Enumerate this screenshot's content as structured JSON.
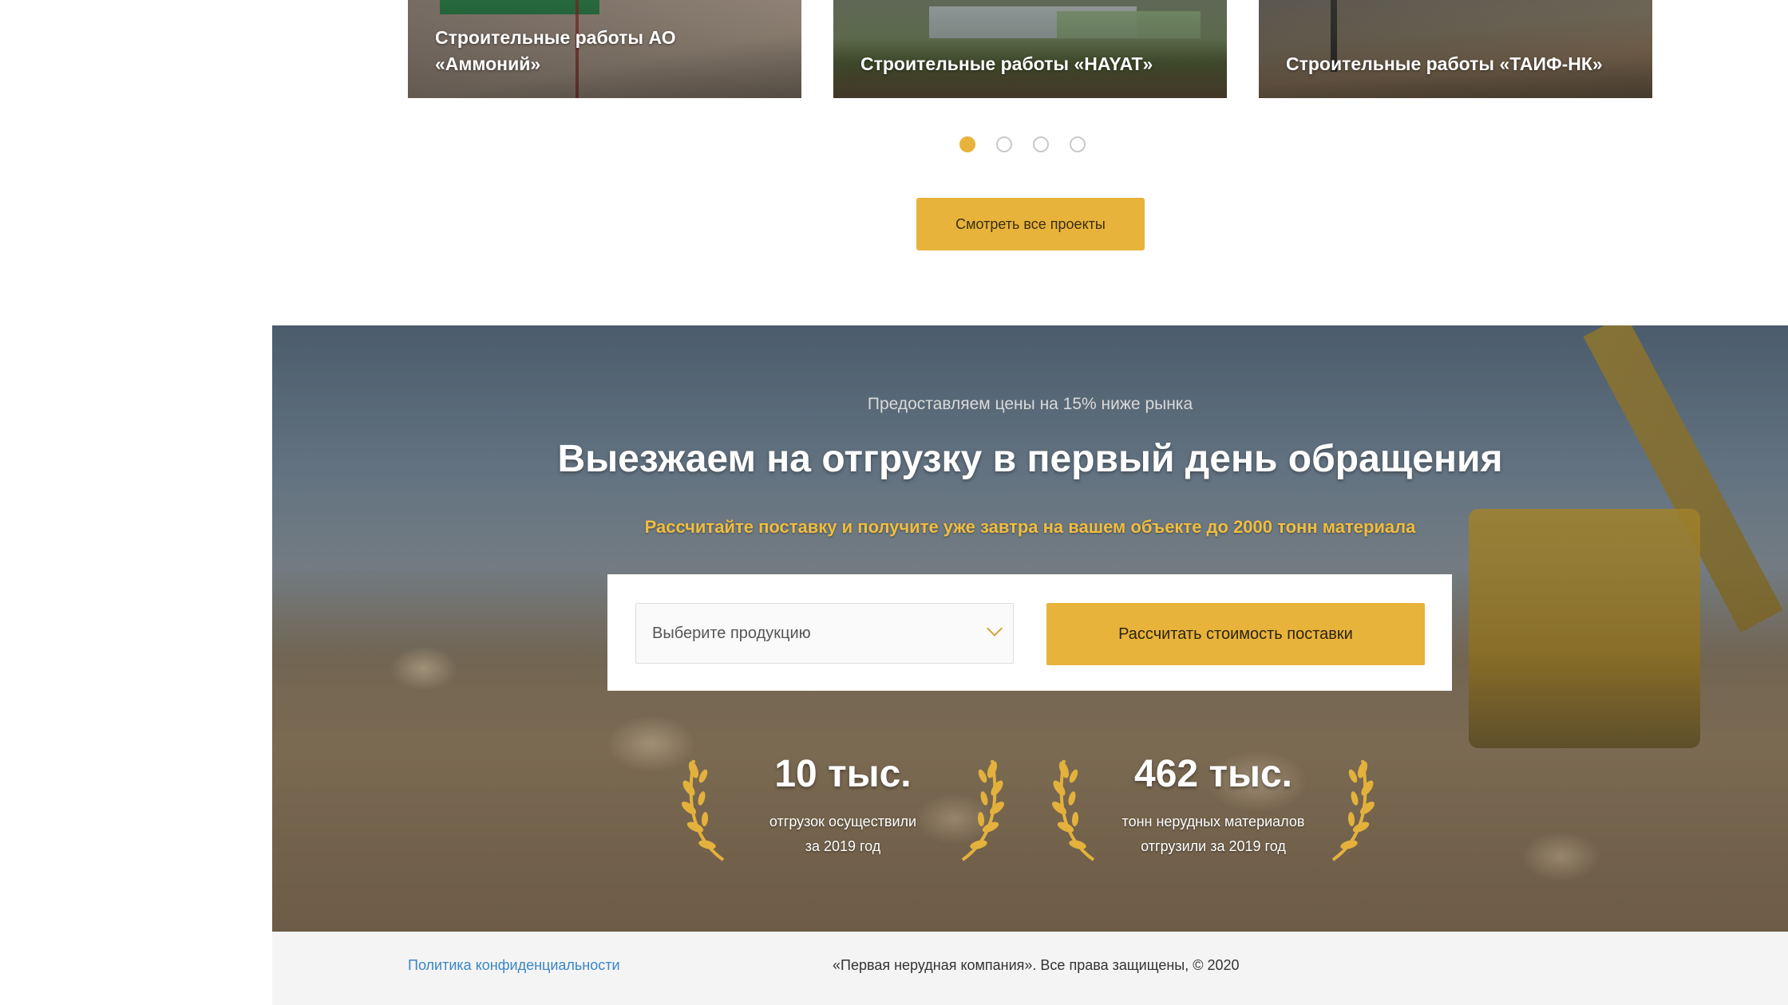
{
  "projects": [
    {
      "title": "Строительные работы АО «Аммоний»"
    },
    {
      "title": "Строительные работы «HAYAT»"
    },
    {
      "title": "Строительные работы «ТАИФ-НК»"
    }
  ],
  "carousel": {
    "active_index": 0,
    "count": 4
  },
  "all_projects_button": "Смотреть все проекты",
  "hero": {
    "subtitle": "Предоставляем цены на 15% ниже рынка",
    "title": "Выезжаем на отгрузку в первый день обращения",
    "accent": "Рассчитайте поставку и получите уже завтра на вашем объекте до 2000 тонн материала"
  },
  "form": {
    "select_placeholder": "Выберите продукцию",
    "calc_button": "Рассчитать стоимость поставки"
  },
  "stats": [
    {
      "value": "10 тыс.",
      "line1": "отгрузок осуществили",
      "line2": "за 2019 год"
    },
    {
      "value": "462 тыс.",
      "line1": "тонн нерудных материалов",
      "line2": "отгрузили за 2019 год"
    }
  ],
  "footer": {
    "privacy": "Политика конфиденциальности",
    "copyright": "«Первая нерудная компания». Все права защищены, © 2020"
  },
  "colors": {
    "accent": "#e8b33a",
    "link": "#3a86c8"
  }
}
